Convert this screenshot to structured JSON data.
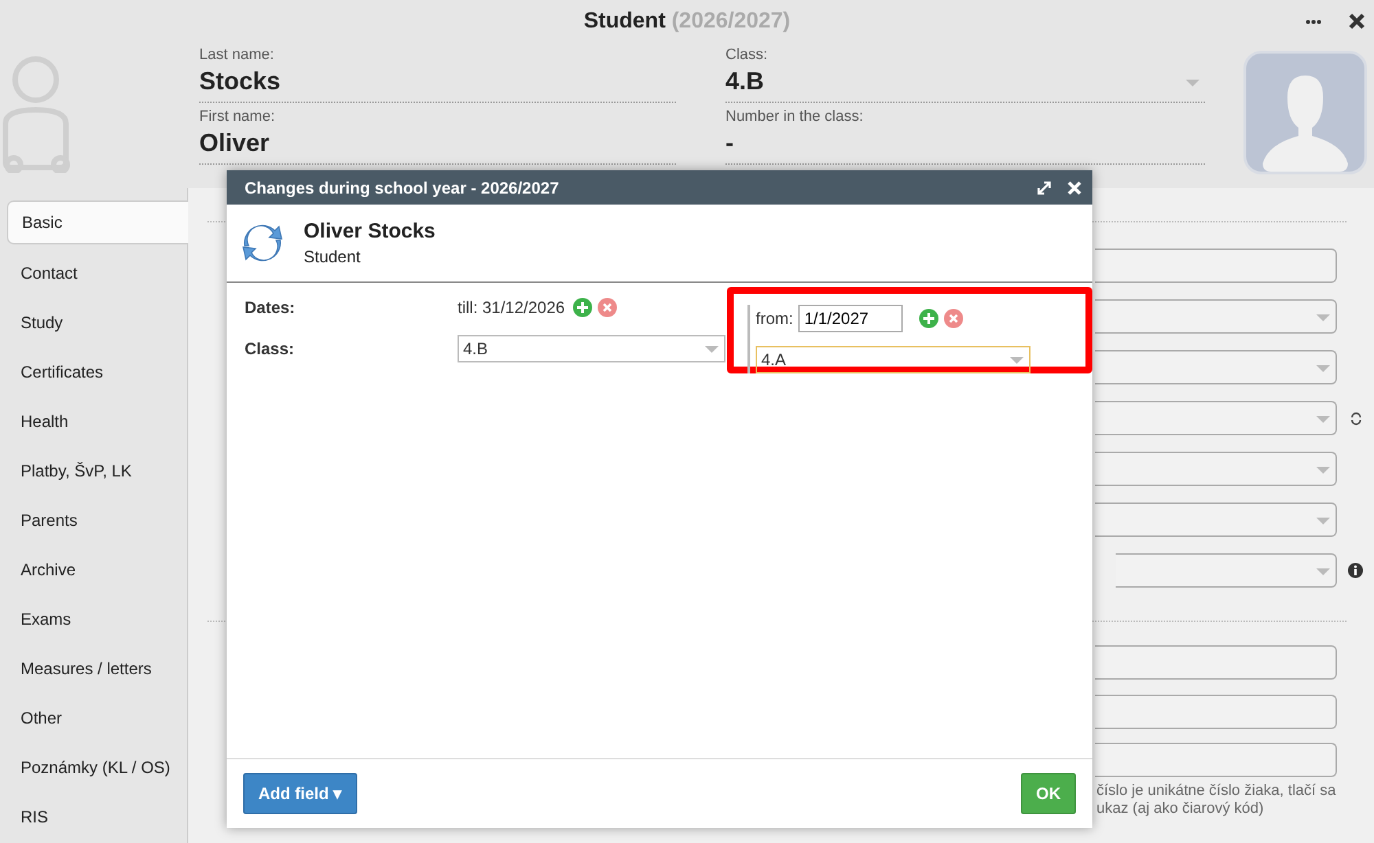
{
  "window": {
    "title": "Student",
    "year": "(2026/2027)"
  },
  "header_fields": [
    {
      "label": "Last name:",
      "value": "Stocks",
      "kind": "text"
    },
    {
      "label": "Class:",
      "value": "4.B",
      "kind": "select"
    },
    {
      "label": "First name:",
      "value": "Oliver",
      "kind": "text"
    },
    {
      "label": "Number in the class:",
      "value": "-",
      "kind": "text"
    }
  ],
  "sidebar": {
    "items": [
      {
        "label": "Basic",
        "selected": true
      },
      {
        "label": "Contact",
        "selected": false
      },
      {
        "label": "Study",
        "selected": false
      },
      {
        "label": "Certificates",
        "selected": false
      },
      {
        "label": "Health",
        "selected": false
      },
      {
        "label": "Platby, ŠvP, LK",
        "selected": false
      },
      {
        "label": "Parents",
        "selected": false
      },
      {
        "label": "Archive",
        "selected": false
      },
      {
        "label": "Exams",
        "selected": false
      },
      {
        "label": "Measures / letters",
        "selected": false
      },
      {
        "label": "Other",
        "selected": false
      },
      {
        "label": "Poznámky (KL / OS)",
        "selected": false
      },
      {
        "label": "RIS",
        "selected": false
      }
    ]
  },
  "background_note": [
    "číslo je unikátne číslo žiaka, tlačí sa",
    "ukaz (aj ako čiarový kód)"
  ],
  "dialog": {
    "title": "Changes during school year - 2026/2027",
    "person": "Oliver Stocks",
    "role": "Student",
    "dates": {
      "label": "Dates:",
      "current": "till: 31/12/2026",
      "new_prefix": "from:",
      "new_value": "1/1/2027"
    },
    "class": {
      "label": "Class:",
      "current": "4.B",
      "new_value": "4.A"
    },
    "buttons": [
      {
        "label": "Add field ▾",
        "kind": "menu"
      },
      {
        "label": "OK",
        "kind": "confirm"
      }
    ]
  }
}
